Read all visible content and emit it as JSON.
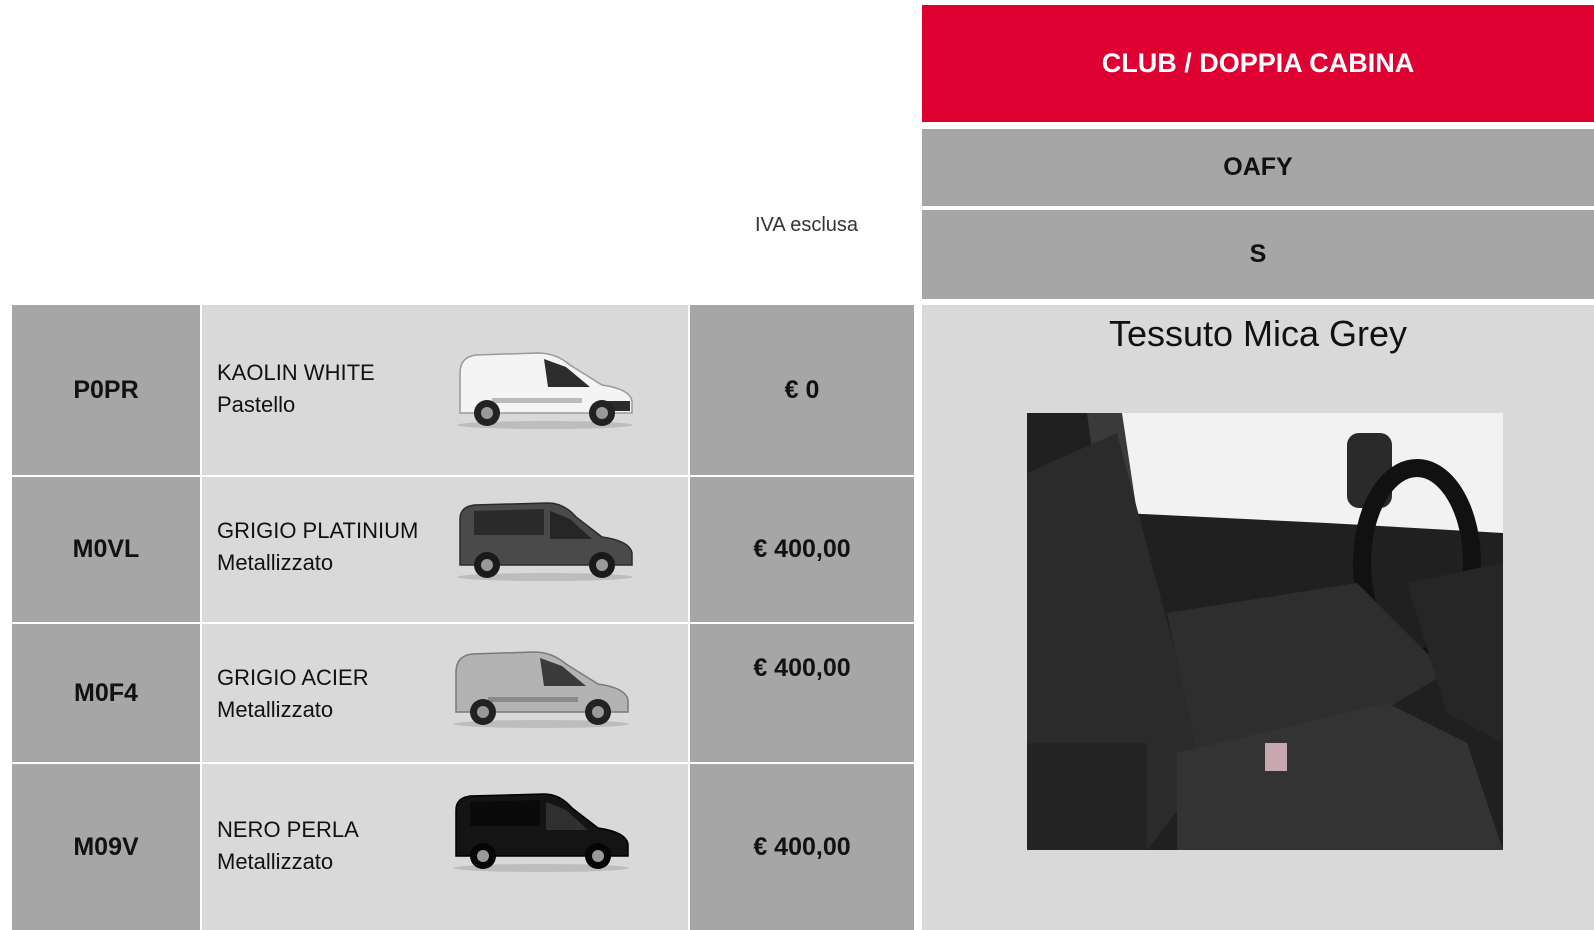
{
  "note": "IVA esclusa",
  "header": {
    "version": "CLUB / DOPPIA CABINA",
    "code": "OAFY",
    "grade": "S"
  },
  "trim": {
    "title": "Tessuto Mica Grey"
  },
  "colors": [
    {
      "code": "P0PR",
      "name": "KAOLIN WHITE",
      "type": "Pastello",
      "price": "€ 0",
      "body_color": "#f4f4f4"
    },
    {
      "code": "M0VL",
      "name": "GRIGIO PLATINIUM",
      "type": "Metallizzato",
      "price": "€ 400,00",
      "body_color": "#4a4a4a"
    },
    {
      "code": "M0F4",
      "name": "GRIGIO ACIER",
      "type": "Metallizzato",
      "price": "€ 400,00",
      "body_color": "#b3b3b3"
    },
    {
      "code": "M09V",
      "name": "NERO PERLA",
      "type": "Metallizzato",
      "price": "€ 400,00",
      "body_color": "#141414"
    }
  ],
  "accent_color": "#dd0031"
}
